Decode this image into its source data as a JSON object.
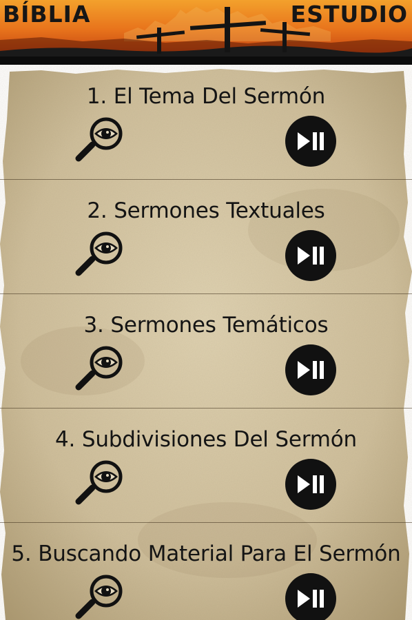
{
  "header": {
    "left_title": "BÍBLIA",
    "right_title": "ESTUDIO"
  },
  "icons": {
    "view": "magnifier-eye-icon",
    "play": "play-pause-icon"
  },
  "colors": {
    "banner_orange": "#e06a1c",
    "banner_dark": "#1a1a1a",
    "parchment": "#d2c2a0",
    "icon_black": "#111111"
  },
  "lessons": [
    {
      "title": "1. El Tema Del Sermón"
    },
    {
      "title": "2. Sermones Textuales"
    },
    {
      "title": "3. Sermones Temáticos"
    },
    {
      "title": "4. Subdivisiones Del Sermón"
    },
    {
      "title": "5. Buscando Material Para El Sermón"
    }
  ]
}
